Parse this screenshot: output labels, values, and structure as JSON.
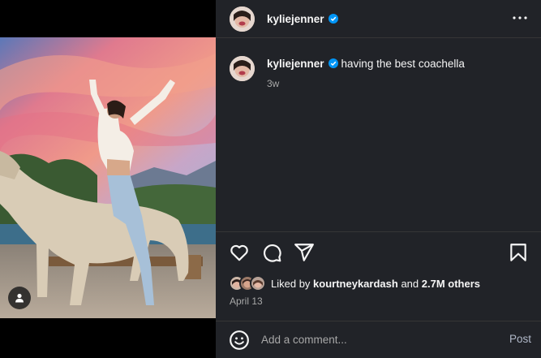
{
  "post": {
    "username": "kyliejenner",
    "verified": true,
    "caption": "having the best coachella",
    "caption_age": "3w",
    "date": "April 13"
  },
  "likes": {
    "prefix": "Liked by",
    "liker": "kourtneykardash",
    "connector": "and",
    "others": "2.7M others"
  },
  "comment": {
    "placeholder": "Add a comment...",
    "post_label": "Post"
  },
  "icons": {
    "more": "more-options-icon",
    "like": "heart-icon",
    "comment": "comment-icon",
    "share": "share-icon",
    "save": "bookmark-icon",
    "emoji": "emoji-icon",
    "tag": "user-tag-icon",
    "verified": "verified-badge-icon"
  },
  "colors": {
    "panel_bg": "#212328",
    "text": "#f5f5f5",
    "muted": "#a8a8a8",
    "verified": "#0095f6"
  }
}
